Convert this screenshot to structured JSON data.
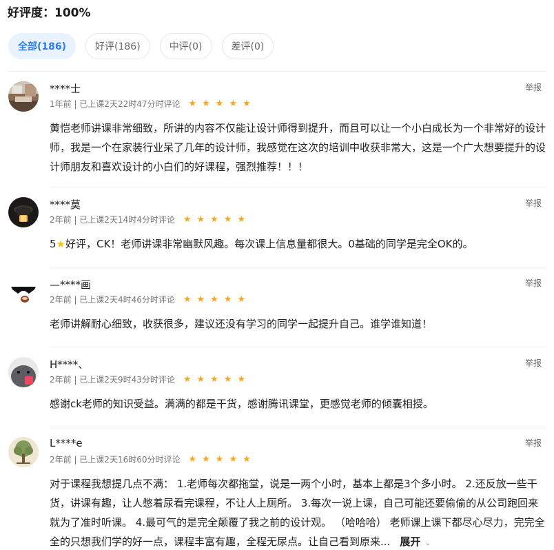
{
  "summary": {
    "label": "好评度：",
    "value": "100%"
  },
  "filters": [
    {
      "label": "全部(186)",
      "active": true
    },
    {
      "label": "好评(186)"
    },
    {
      "label": "中评(0)"
    },
    {
      "label": "差评(0)"
    }
  ],
  "report_label": "举报",
  "rating": 5,
  "reviews": [
    {
      "name": "****士",
      "meta": "1年前 | 已上课2天22时47分时评论",
      "content": "黄恺老师讲课非常细致，所讲的内容不仅能让设计师得到提升，而且可以让一个小白成长为一个非常好的设计师，我是一个在家装行业呆了几年的设计师，我感觉在这次的培训中收获非常大，这是一个广大想要提升的设计师朋友和喜欢设计的小白们的好课程，强烈推荐！！！",
      "avatar_icon": "room-photo-icon"
    },
    {
      "name": "****莫",
      "meta": "2年前 | 已上课2天14时4分时评论",
      "content_before": "5",
      "content_after": "好评，CK！老师讲课非常幽默风趣。每次课上信息量都很大。0基础的同学是完全OK的。",
      "avatar_icon": "lamp-icon"
    },
    {
      "name": "—****画",
      "meta": "2年前 | 已上课2天4时46分时评论",
      "content": "老师讲解耐心细致，收获很多，建议还没有学习的同学一起提升自己。谁学谁知道！",
      "avatar_icon": "sunglasses-face-icon"
    },
    {
      "name": "H****、",
      "meta": "2年前 | 已上课2天9时43分时评论",
      "content": "感谢ck老师的知识受益。满满的都是干货，感谢腾讯课堂，更感觉老师的倾囊相授。",
      "avatar_icon": "cartoon-seal-icon"
    },
    {
      "name": "L****e",
      "meta": "2年前 | 已上课2天16时60分时评论",
      "content": "对于课程我想提几点不满： 1.老师每次都拖堂，说是一两个小时，基本上都是3个多小时。 2.还反放一些干货，讲课有趣，让人憋着尿看完课程，不让人上厕所。 3.每次一说上课，自己可能还要偷偷的从公司跑回来就为了准时听课。 4.最可气的是完全颠覆了我之前的设计观。 （哈哈哈） 老师课上课下都尽心尽力，完完全全的只想我们学的好一点，课程丰富有趣，全程无尿点。让自己看到原来...",
      "expand_label": "展开",
      "avatar_icon": "tree-icon"
    }
  ],
  "colors": {
    "accent": "#2b7cf0",
    "star": "#f5a623"
  }
}
